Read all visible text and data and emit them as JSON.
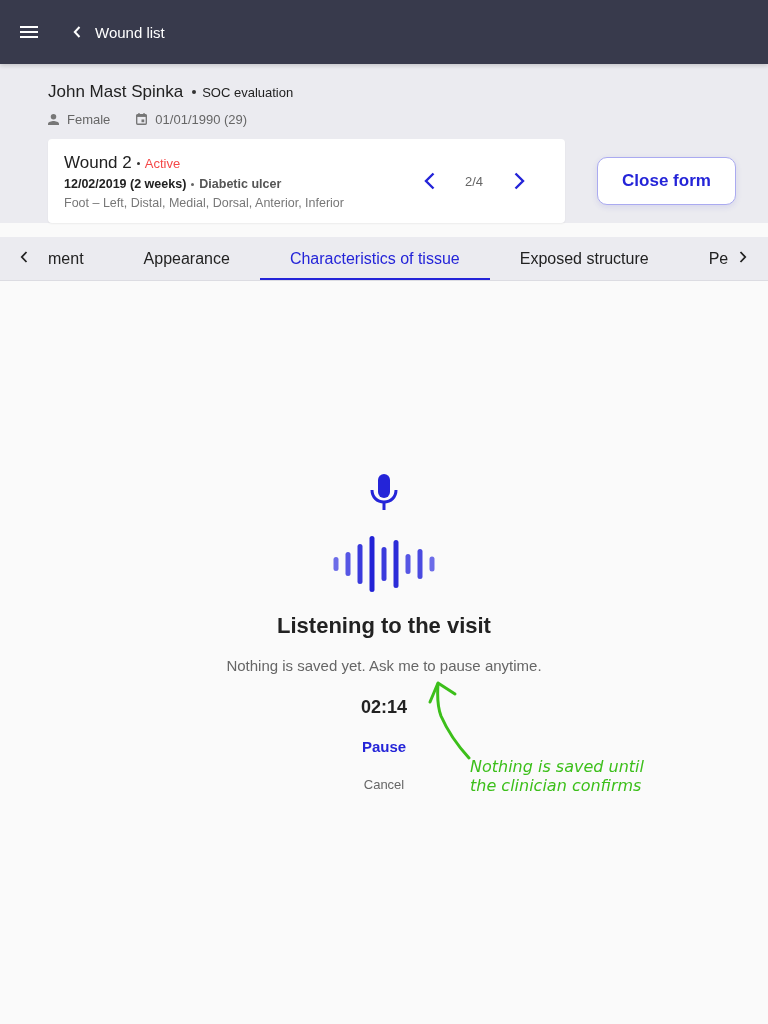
{
  "top_bar": {
    "back_label": "Wound list"
  },
  "patient": {
    "name": "John Mast Spinka",
    "visit_type": "SOC evaluation",
    "sex": "Female",
    "birth_date": "01/01/1990 (29)"
  },
  "wound_card": {
    "title": "Wound 2",
    "status": "Active",
    "date": "12/02/2019 (2 weeks)",
    "type": "Diabetic ulcer",
    "location": "Foot – Left, Distal, Medial, Dorsal, Anterior, Inferior",
    "position": "2/4"
  },
  "close_button": {
    "label": "Close form"
  },
  "tabs": [
    {
      "label": "ment",
      "selected": false
    },
    {
      "label": "Appearance",
      "selected": false
    },
    {
      "label": "Characteristics of tissue",
      "selected": true
    },
    {
      "label": "Exposed structure",
      "selected": false
    },
    {
      "label": "Pe",
      "selected": false
    }
  ],
  "listening": {
    "title": "Listening to the visit",
    "message": "Nothing is saved yet. Ask me to pause anytime.",
    "timer": "02:14",
    "pause_label": "Pause",
    "cancel_label": "Cancel"
  },
  "annotation": {
    "text": "Nothing is saved until the clinician confirms"
  }
}
